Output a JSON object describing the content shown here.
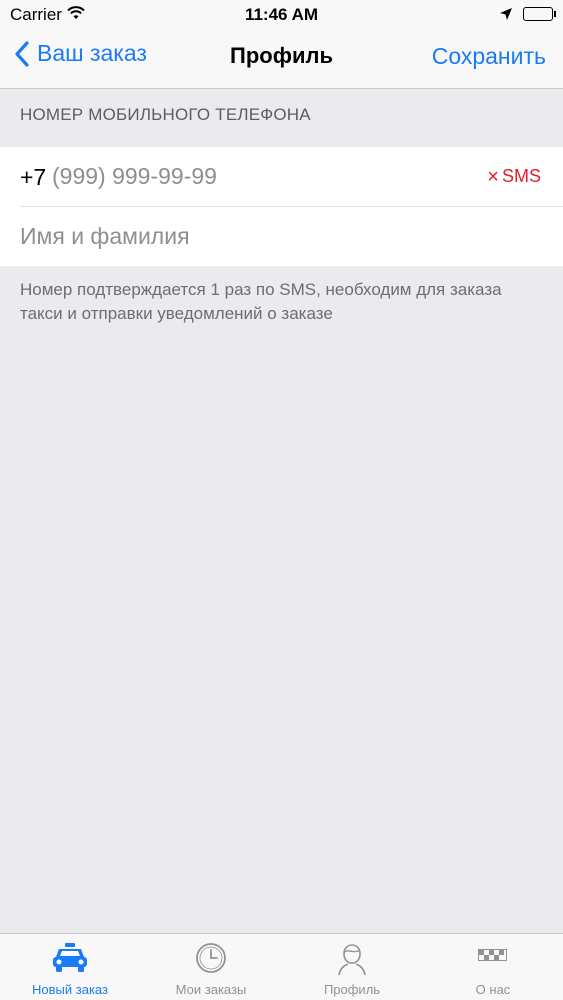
{
  "status_bar": {
    "carrier": "Carrier",
    "time": "11:46 AM"
  },
  "nav": {
    "back_label": "Ваш заказ",
    "title": "Профиль",
    "save_label": "Сохранить"
  },
  "section": {
    "header": "НОМЕР МОБИЛЬНОГО ТЕЛЕФОНА",
    "phone_prefix": "+7",
    "phone_placeholder": "(999) 999-99-99",
    "sms_label": "SMS",
    "name_placeholder": "Имя и фамилия",
    "footer": "Номер подтверждается 1 раз по SMS, необходим для заказа такси и отправки уведомлений о заказе"
  },
  "tabs": [
    {
      "label": "Новый заказ",
      "icon": "taxi-icon",
      "active": true
    },
    {
      "label": "Мои заказы",
      "icon": "clock-icon",
      "active": false
    },
    {
      "label": "Профиль",
      "icon": "person-icon",
      "active": false
    },
    {
      "label": "О нас",
      "icon": "taxi-checker-icon",
      "active": false
    }
  ],
  "colors": {
    "accent": "#1b7bf5",
    "sms_red": "#e0202a",
    "background": "#ebebed"
  }
}
